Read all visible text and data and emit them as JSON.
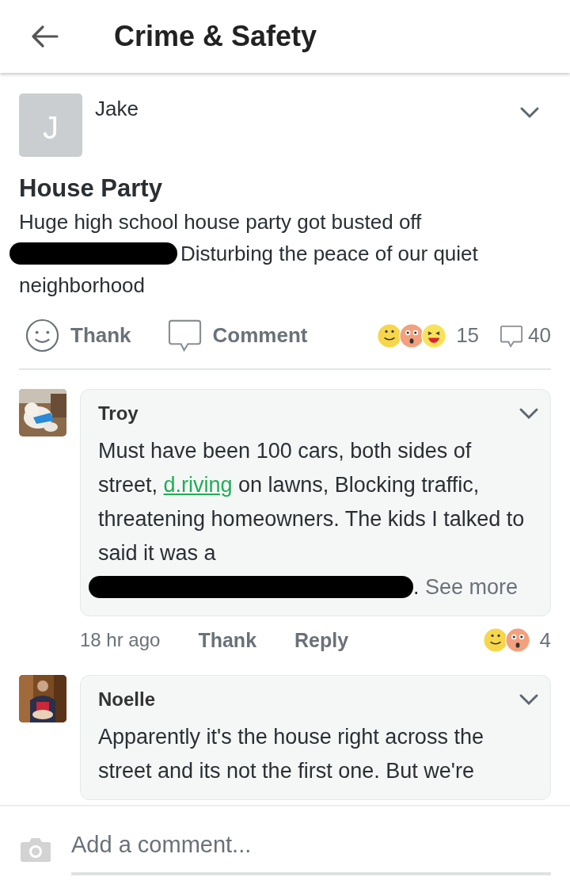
{
  "header": {
    "title": "Crime & Safety"
  },
  "post": {
    "author": "Jake",
    "avatar_letter": "J",
    "title": "House Party",
    "body": [
      {
        "kind": "text",
        "text": "Huge high school house party got busted off"
      },
      {
        "kind": "redacted"
      },
      {
        "kind": "text",
        "text": "Disturbing the peace of our quiet neighborhood"
      }
    ],
    "actions": [
      {
        "kind": "thank",
        "label": "Thank"
      },
      {
        "kind": "comment",
        "label": "Comment"
      }
    ],
    "reactions": [
      {
        "kind": "smile"
      },
      {
        "kind": "wow"
      },
      {
        "kind": "laugh"
      }
    ],
    "reaction_count": "15",
    "comment_count": "40"
  },
  "comments": [
    {
      "author": "Troy",
      "body": [
        {
          "kind": "text",
          "text": "Must have been 100 cars, both sides of street, "
        },
        {
          "kind": "link",
          "text": "d.riving"
        },
        {
          "kind": "text",
          "text": " on lawns, Blocking traffic, threatening homeowners. The kids I talked to said it was a "
        },
        {
          "kind": "redacted"
        },
        {
          "kind": "text",
          "text": ". "
        },
        {
          "kind": "more",
          "text": "See more"
        }
      ],
      "time": "18 hr ago",
      "actions": [
        "Thank",
        "Reply"
      ],
      "reactions": [
        {
          "kind": "smile"
        },
        {
          "kind": "wow"
        }
      ],
      "reaction_count": "4"
    },
    {
      "author": "Noelle",
      "body": [
        {
          "kind": "text",
          "text": "Apparently it's the house right across the street and its not the first one. But we're"
        }
      ]
    }
  ],
  "composer": {
    "placeholder": "Add a comment..."
  }
}
